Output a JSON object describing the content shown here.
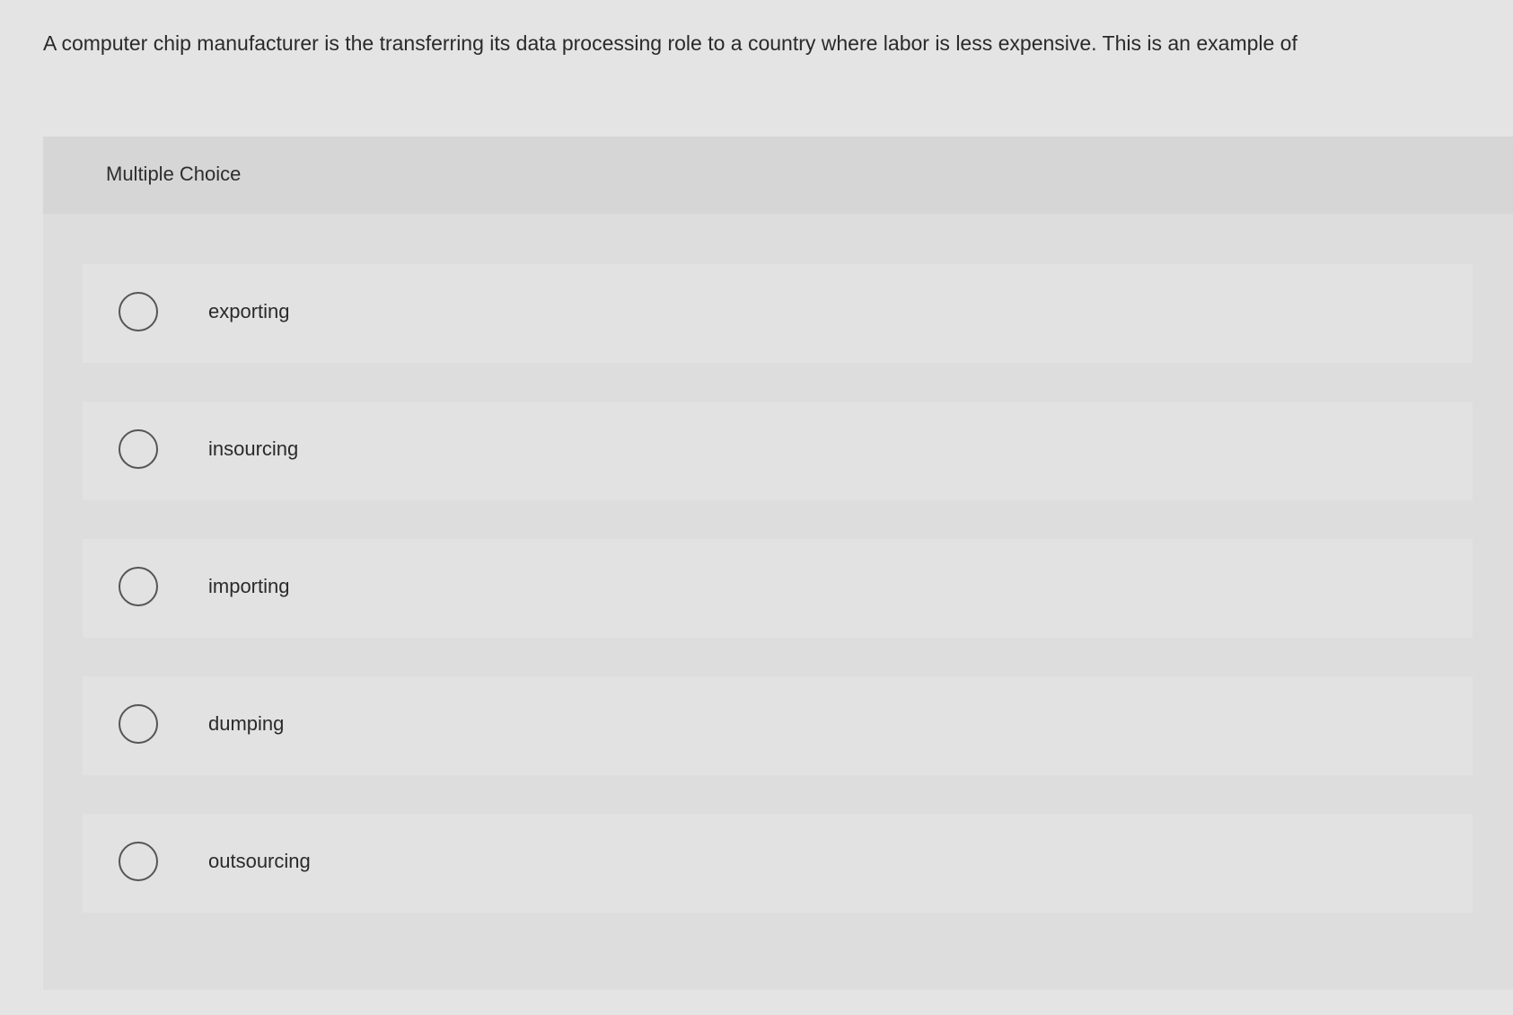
{
  "question": {
    "text": "A computer chip manufacturer is the transferring its data processing role to a country where labor is less expensive. This is an example of"
  },
  "multiple_choice": {
    "header": "Multiple Choice",
    "options": [
      {
        "label": "exporting"
      },
      {
        "label": "insourcing"
      },
      {
        "label": "importing"
      },
      {
        "label": "dumping"
      },
      {
        "label": "outsourcing"
      }
    ]
  }
}
